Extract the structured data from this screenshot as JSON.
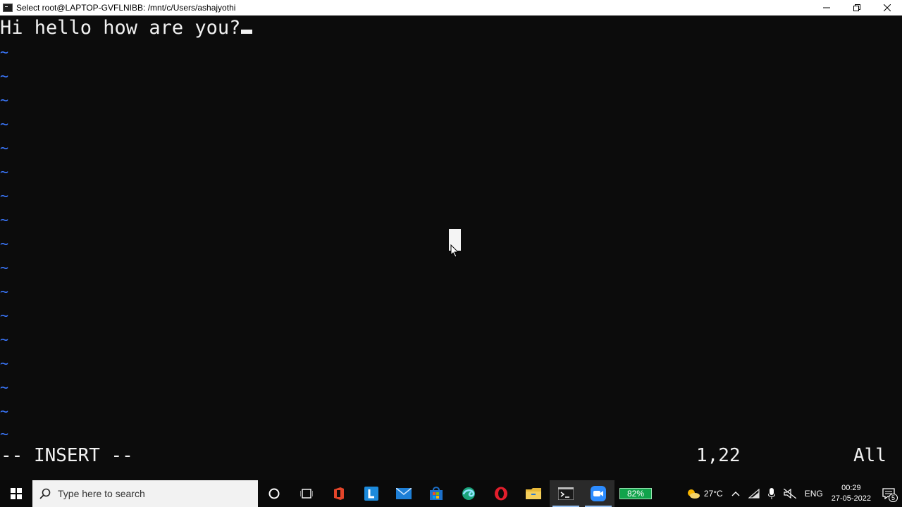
{
  "window": {
    "title": "Select root@LAPTOP-GVFLNIBB: /mnt/c/Users/ashajyothi"
  },
  "editor": {
    "lines": [
      "Hi hello how are you?"
    ],
    "tilde_char": "~",
    "mode": "-- INSERT --",
    "position": "1,22",
    "scroll": "All",
    "text_color": "#f2f2f2",
    "tilde_color": "#3b78ff",
    "background": "#0c0c0c"
  },
  "taskbar": {
    "search_placeholder": "Type here to search",
    "battery": "82%",
    "weather": "27°C",
    "language": "ENG",
    "time": "00:29",
    "date": "27-05-2022",
    "notifications": "5",
    "apps": [
      "cortana-icon",
      "task-view-icon",
      "office-icon",
      "l-app-icon",
      "mail-icon",
      "store-icon",
      "edge-icon",
      "opera-icon",
      "file-explorer-icon",
      "terminal-icon",
      "zoom-icon"
    ]
  }
}
